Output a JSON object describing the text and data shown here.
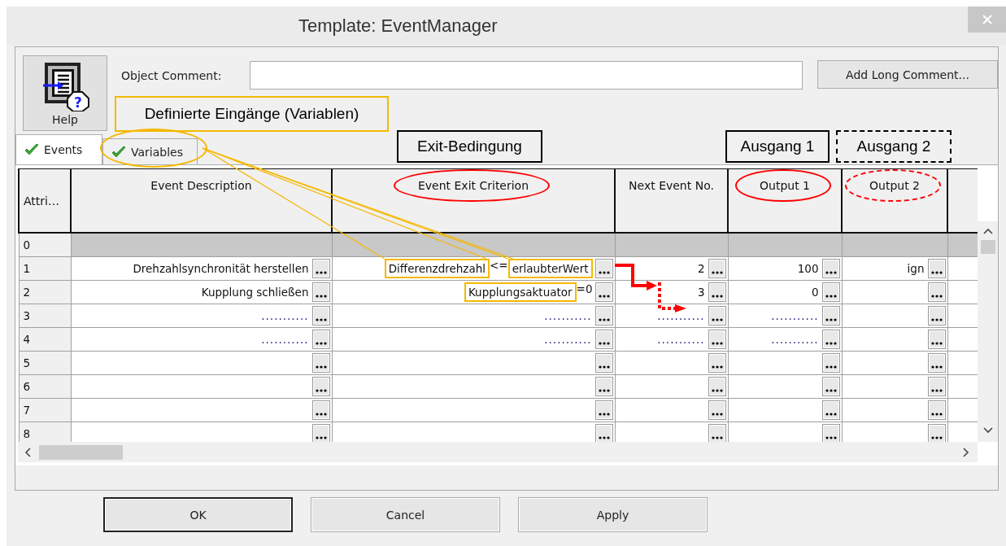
{
  "window": {
    "title": "Template: EventManager"
  },
  "help_button": {
    "label": "Help",
    "badge": "?"
  },
  "object_comment": {
    "label": "Object Comment:"
  },
  "add_long_comment_button": {
    "label": "Add Long Comment..."
  },
  "callouts": [
    {
      "kind": "input",
      "text": "Definierte Eingänge (Variablen)"
    },
    {
      "kind": "solid",
      "text": "Exit-Bedingung"
    },
    {
      "kind": "solid",
      "text": "Ausgang 1"
    },
    {
      "kind": "dashed",
      "text": "Ausgang 2"
    }
  ],
  "tabs": [
    {
      "label": "Events",
      "selected": true,
      "circled": false
    },
    {
      "label": "Variables",
      "selected": false,
      "circled": true
    }
  ],
  "table": {
    "columns": [
      {
        "label": "Attri…"
      },
      {
        "label": "Event Description"
      },
      {
        "label": "Event Exit Criterion",
        "circled": true,
        "dashed": false
      },
      {
        "label": "Next Event No."
      },
      {
        "label": "Output 1",
        "circled": true,
        "dashed": false
      },
      {
        "label": "Output 2",
        "circled": true,
        "dashed": true
      }
    ],
    "rows": [
      {
        "number": "0",
        "shaded": true
      },
      {
        "number": "1",
        "shaded": false,
        "cells": [
          {
            "kind": "text",
            "text": "Drehzahlsynchronität herstellen"
          },
          {
            "kind": "expression",
            "parts": [
              {
                "text": "Differenzdrehzahl",
                "highlight": true
              },
              {
                "text": "<=",
                "highlight": false
              },
              {
                "text": "erlaubterWert",
                "highlight": true
              }
            ]
          },
          {
            "kind": "text",
            "text": "2"
          },
          {
            "kind": "text",
            "text": "100"
          },
          {
            "kind": "text",
            "text": "ign"
          }
        ]
      },
      {
        "number": "2",
        "shaded": false,
        "cells": [
          {
            "kind": "text",
            "text": "Kupplung schließen"
          },
          {
            "kind": "expression",
            "parts": [
              {
                "text": "Kupplungsaktuator",
                "highlight": true
              },
              {
                "text": "=0",
                "highlight": false
              }
            ]
          },
          {
            "kind": "text",
            "text": "3"
          },
          {
            "kind": "text",
            "text": "0"
          }
        ]
      },
      {
        "number": "3",
        "shaded": false,
        "cells": [
          {
            "kind": "placeholder",
            "text": "..........."
          },
          {
            "kind": "placeholder",
            "text": "..........."
          },
          {
            "kind": "placeholder",
            "text": "..........."
          },
          {
            "kind": "placeholder",
            "text": "..........."
          }
        ]
      },
      {
        "number": "4",
        "shaded": false,
        "cells": [
          {
            "kind": "placeholder",
            "text": "..........."
          },
          {
            "kind": "placeholder",
            "text": "..........."
          },
          {
            "kind": "placeholder",
            "text": "..........."
          },
          {
            "kind": "placeholder",
            "text": "..........."
          }
        ]
      },
      {
        "number": "5",
        "shaded": false
      },
      {
        "number": "6",
        "shaded": false
      },
      {
        "number": "7",
        "shaded": false
      },
      {
        "number": "8",
        "shaded": false
      }
    ]
  },
  "buttons": [
    {
      "label": "OK",
      "default": true
    },
    {
      "label": "Cancel",
      "default": false
    },
    {
      "label": "Apply",
      "default": false
    }
  ]
}
